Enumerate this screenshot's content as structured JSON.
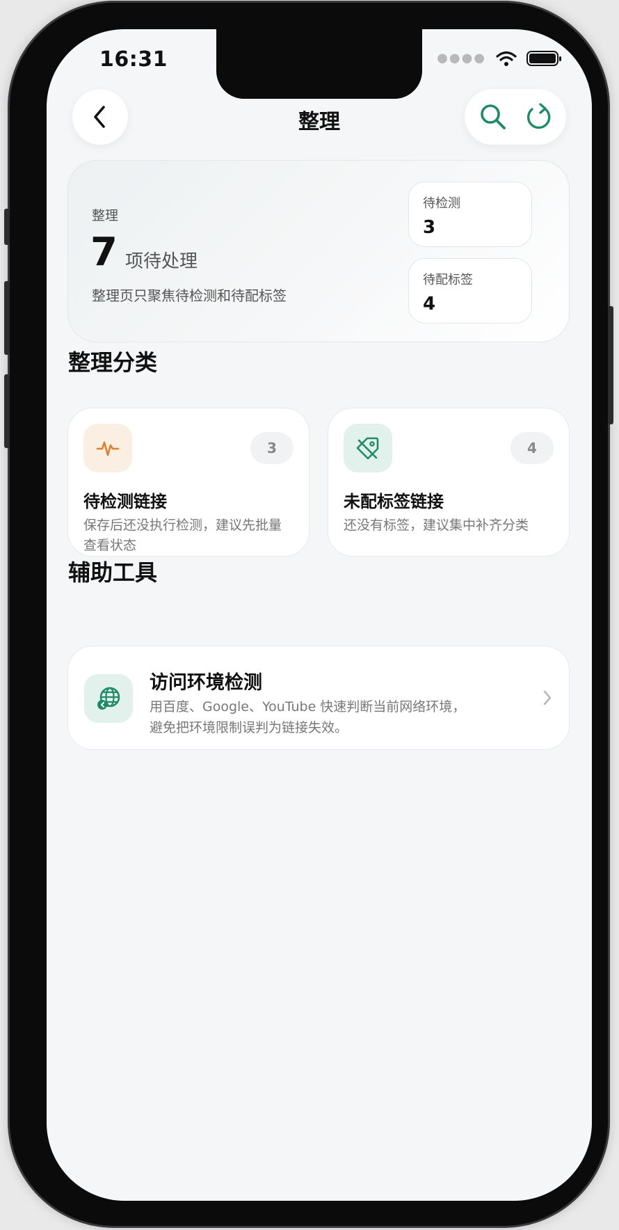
{
  "status_bar": {
    "time": "16:31"
  },
  "nav": {
    "title": "整理"
  },
  "summary": {
    "label": "整理",
    "count": "7",
    "unit": "项待处理",
    "description": "整理页只聚焦待检测和待配标签",
    "pending_check": {
      "label": "待检测",
      "value": "3"
    },
    "pending_tag": {
      "label": "待配标签",
      "value": "4"
    }
  },
  "categories": {
    "title": "整理分类",
    "items": [
      {
        "title": "待检测链接",
        "description": "保存后还没执行检测，建议先批量查看状态",
        "count": "3",
        "icon": "pulse-icon",
        "icon_color": "#d9822b",
        "icon_bg": "#fbeee2"
      },
      {
        "title": "未配标签链接",
        "description": "还没有标签，建议集中补齐分类",
        "count": "4",
        "icon": "tag-off-icon",
        "icon_color": "#1f8a68",
        "icon_bg": "#e3f1ec"
      }
    ]
  },
  "tools": {
    "title": "辅助工具",
    "items": [
      {
        "title": "访问环境检测",
        "description": "用百度、Google、YouTube 快速判断当前网络环境，避免把环境限制误判为链接失效。",
        "icon": "globe-icon"
      }
    ]
  },
  "colors": {
    "accent": "#1f8a68",
    "warning": "#d9822b",
    "background": "#f5f6f8"
  }
}
